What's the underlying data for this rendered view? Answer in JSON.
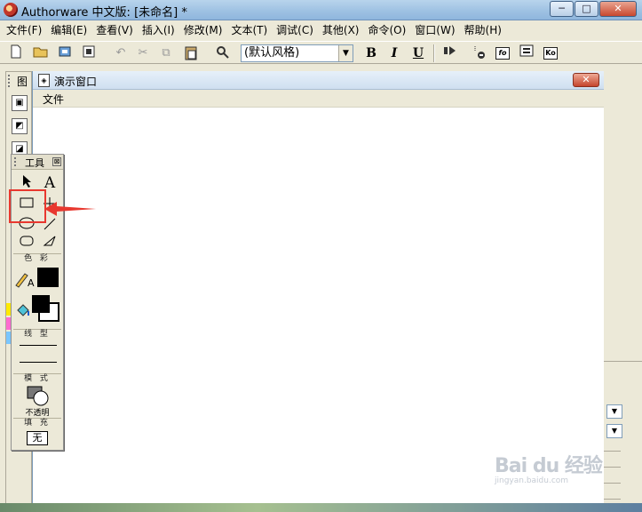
{
  "window": {
    "title": "Authorware 中文版: [未命名] *",
    "controls": {
      "minimize": "─",
      "maximize": "□",
      "close": "✕"
    }
  },
  "menubar": {
    "items": [
      {
        "label": "文件(F)"
      },
      {
        "label": "编辑(E)"
      },
      {
        "label": "查看(V)"
      },
      {
        "label": "插入(I)"
      },
      {
        "label": "修改(M)"
      },
      {
        "label": "文本(T)"
      },
      {
        "label": "调试(C)"
      },
      {
        "label": "其他(X)"
      },
      {
        "label": "命令(O)"
      },
      {
        "label": "窗口(W)"
      },
      {
        "label": "帮助(H)"
      }
    ]
  },
  "toolbar": {
    "style_select": {
      "value": "(默认风格)"
    },
    "bold_label": "B",
    "italic_label": "I",
    "underline_label": "U",
    "fo_label": "fo",
    "ko_label": "Ko"
  },
  "presentation_window": {
    "title": "演示窗口",
    "close": "✕",
    "menu": {
      "file_label": "文件"
    }
  },
  "left_panel": {
    "title": "图"
  },
  "toolbox": {
    "title": "工具",
    "close": "⊠",
    "text_tool_label": "A",
    "color_section": "色 彩",
    "line_section": "线 型",
    "mode_section": "模 式",
    "mode_value": "不透明",
    "fill_section": "填 充",
    "fill_value": "无",
    "highlighted_tool": "rectangle-tool"
  },
  "watermark": {
    "brand": "Bai du 经验",
    "url": "jingyan.baidu.com"
  },
  "colors": {
    "highlight": "#e8382f",
    "arrow": "#e8382f",
    "titlebar": "#9dc0e2",
    "chrome": "#ece9d8"
  }
}
